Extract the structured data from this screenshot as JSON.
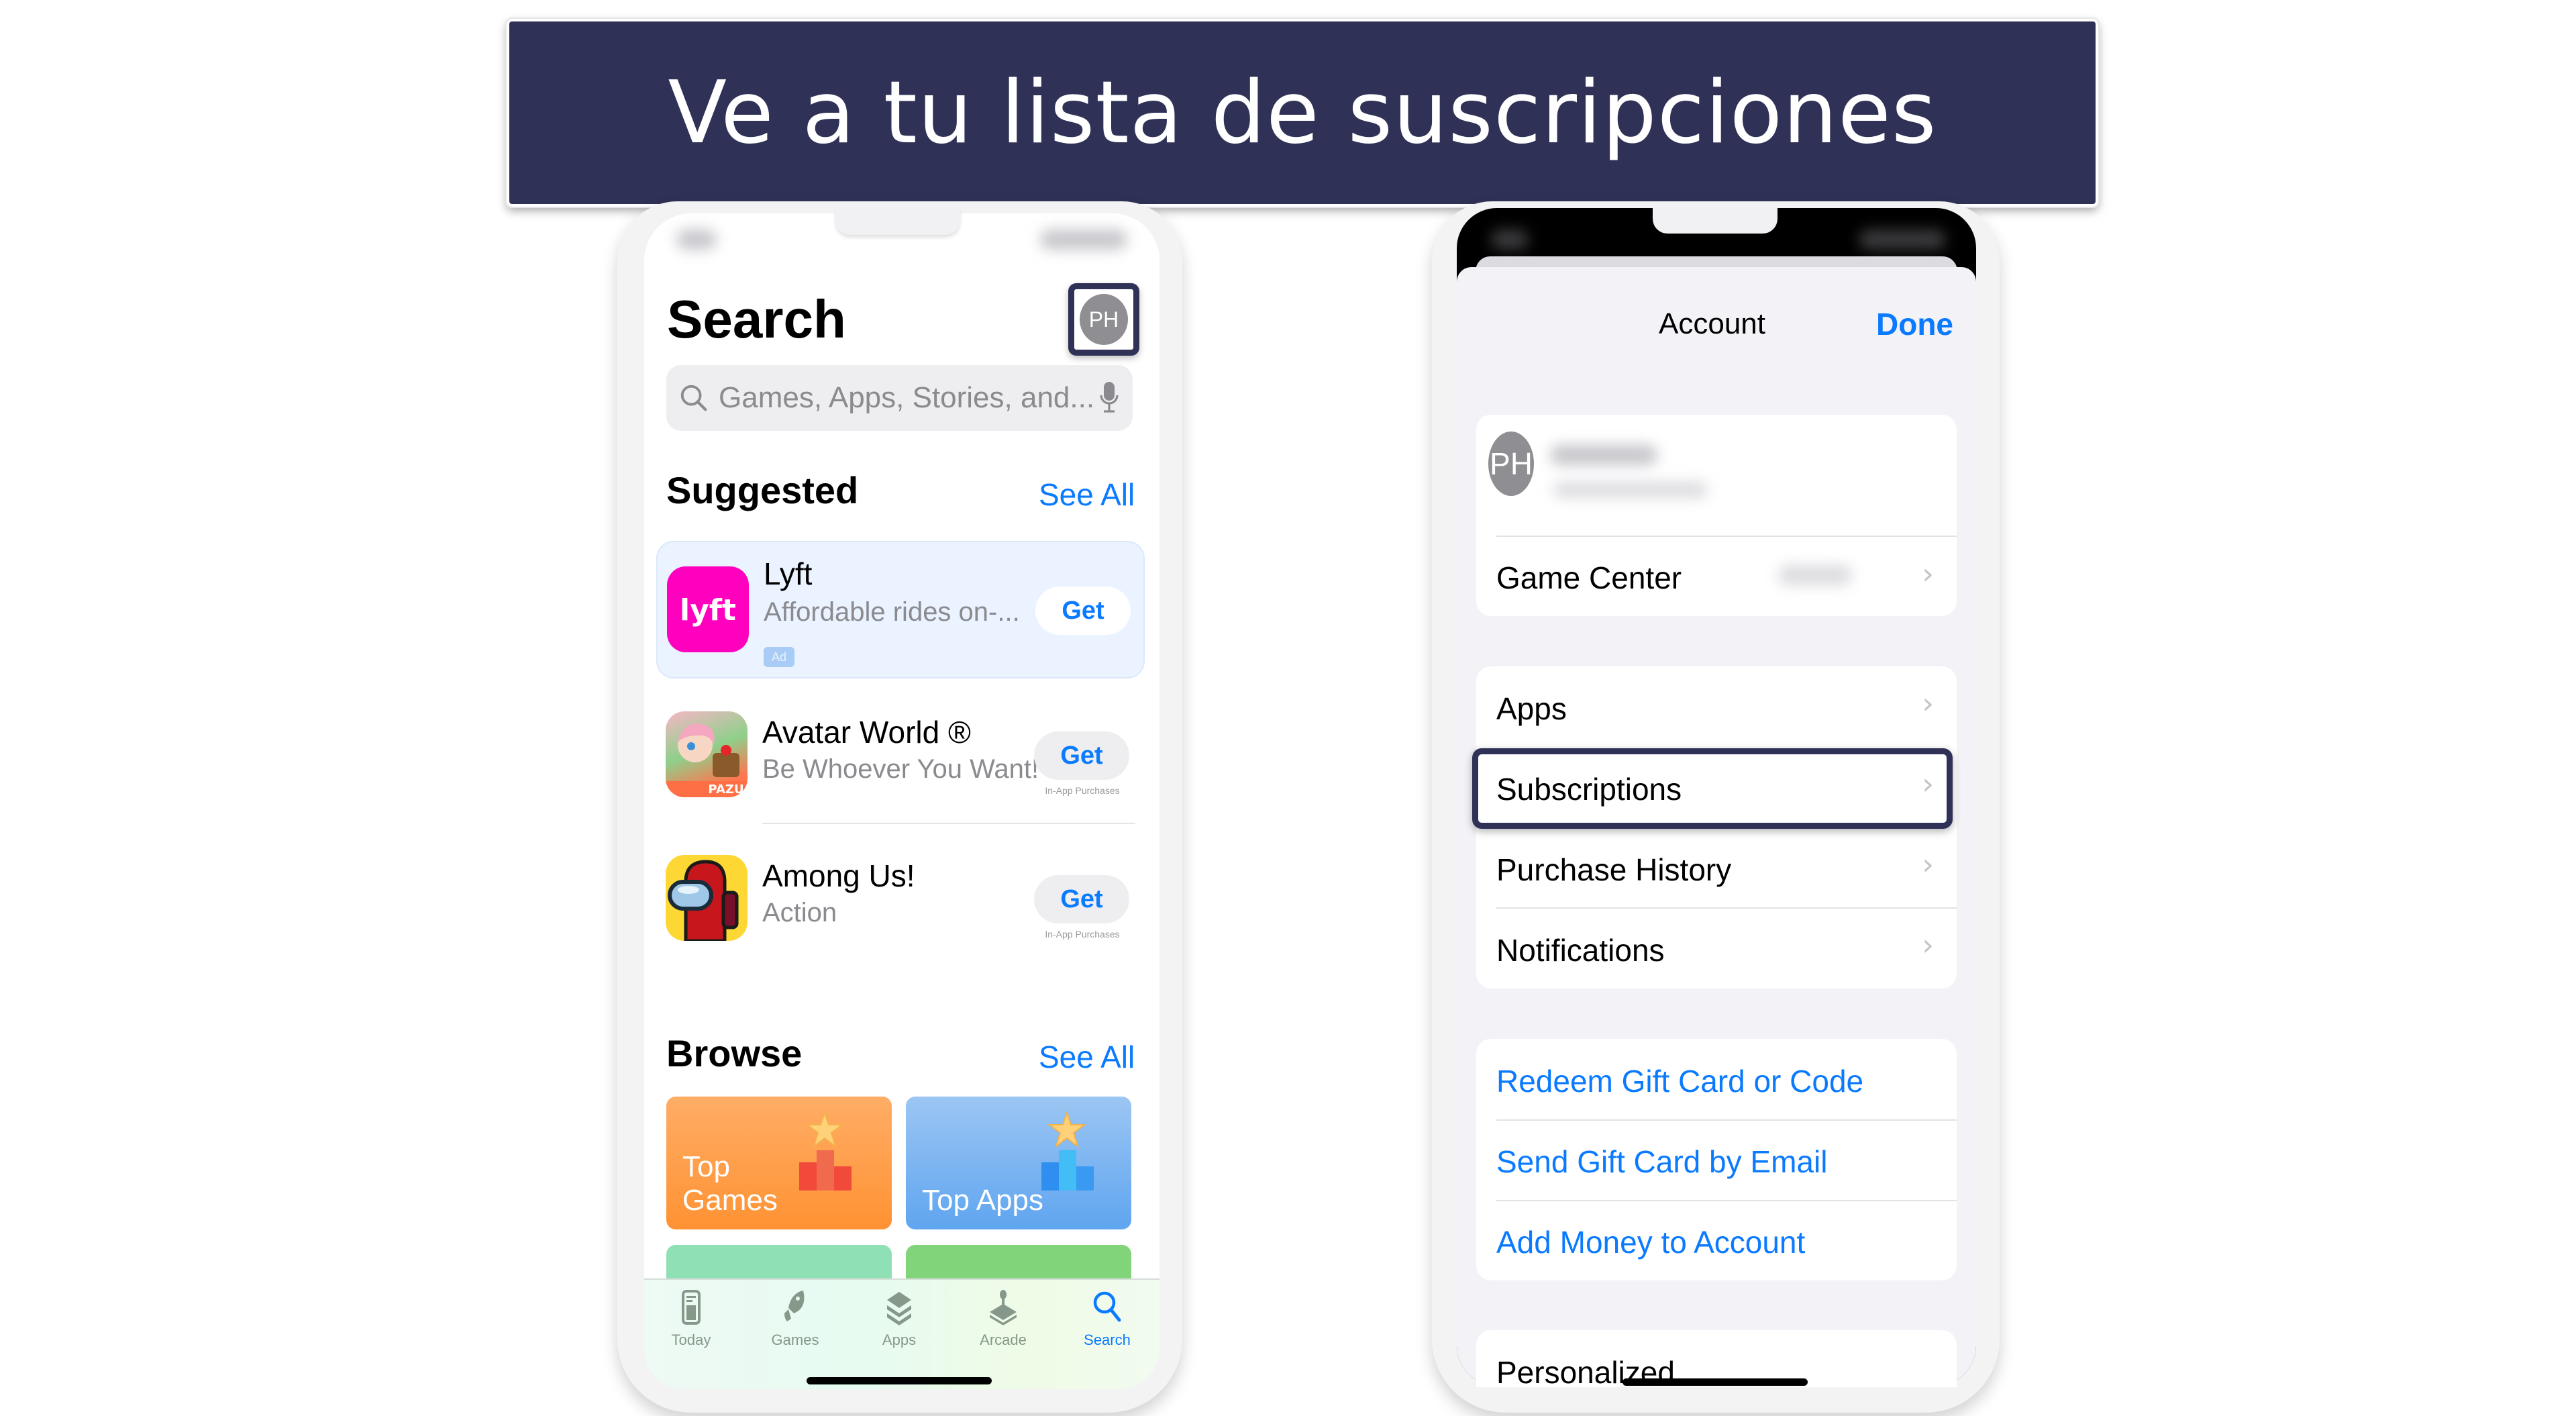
{
  "banner": {
    "title": "Ve a tu lista de suscripciones",
    "background": "#2f3256"
  },
  "left_screen": {
    "title": "Search",
    "avatar_initials": "PH",
    "search": {
      "placeholder": "Games, Apps, Stories, and..."
    },
    "suggested": {
      "title": "Suggested",
      "see_all": "See All",
      "apps": [
        {
          "name": "Lyft",
          "subtitle": "Affordable rides on-...",
          "badge": "Ad",
          "button": "Get",
          "note": ""
        },
        {
          "name": "Avatar World ®",
          "subtitle": "Be Whoever You Want!",
          "button": "Get",
          "note": "In-App Purchases"
        },
        {
          "name": "Among Us!",
          "subtitle": "Action",
          "button": "Get",
          "note": "In-App Purchases"
        }
      ]
    },
    "browse": {
      "title": "Browse",
      "see_all": "See All",
      "cards": [
        {
          "label": "Top\nGames",
          "color": "#ff9a3d"
        },
        {
          "label": "Top Apps",
          "color": "#62a6f0"
        },
        {
          "label": "",
          "color": "#8fe0b4"
        },
        {
          "label": "",
          "color": "#82d47a"
        }
      ]
    },
    "tabbar": {
      "tabs": [
        {
          "label": "Today",
          "icon": "today-icon",
          "active": false
        },
        {
          "label": "Games",
          "icon": "rocket-icon",
          "active": false
        },
        {
          "label": "Apps",
          "icon": "layers-icon",
          "active": false
        },
        {
          "label": "Arcade",
          "icon": "joystick-icon",
          "active": false
        },
        {
          "label": "Search",
          "icon": "search-icon",
          "active": true
        }
      ]
    }
  },
  "right_screen": {
    "title": "Account",
    "done": "Done",
    "avatar_initials": "PH",
    "game_center": "Game Center",
    "menu": [
      "Apps",
      "Subscriptions",
      "Purchase History",
      "Notifications"
    ],
    "links": [
      "Redeem Gift Card or Code",
      "Send Gift Card by Email",
      "Add Money to Account"
    ],
    "partial": "Personalized",
    "highlighted": "Subscriptions"
  },
  "colors": {
    "accent_blue": "#0a7aff",
    "highlight_border": "#2f3256",
    "lyft_pink": "#ff00bf"
  }
}
